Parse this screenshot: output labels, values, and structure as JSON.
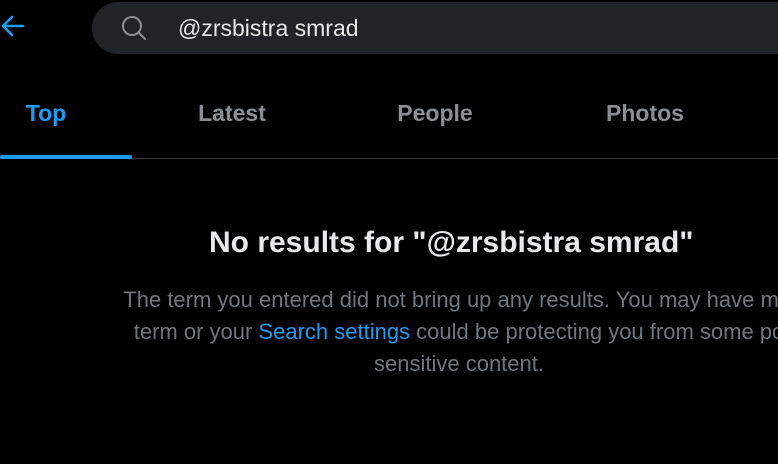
{
  "colors": {
    "accent": "#1d9bf0",
    "background": "#000000",
    "search_bg": "#202327",
    "primary_text": "#e7e9ea",
    "secondary_text": "#71767b"
  },
  "header": {
    "back_icon": "arrow-left-icon",
    "search": {
      "icon": "search-icon",
      "value": "@zrsbistra smrad"
    }
  },
  "tabs": [
    {
      "label": "Top",
      "active": true
    },
    {
      "label": "Latest",
      "active": false
    },
    {
      "label": "People",
      "active": false
    },
    {
      "label": "Photos",
      "active": false
    }
  ],
  "empty_state": {
    "title": "No results for \"@zrsbistra smrad\"",
    "message_line1": "The term you entered did not bring up any results. You may have mis",
    "message_pre_link": "term or your ",
    "link_text": "Search settings",
    "message_post_link": " could be protecting you from some po",
    "message_line3": "sensitive content."
  }
}
